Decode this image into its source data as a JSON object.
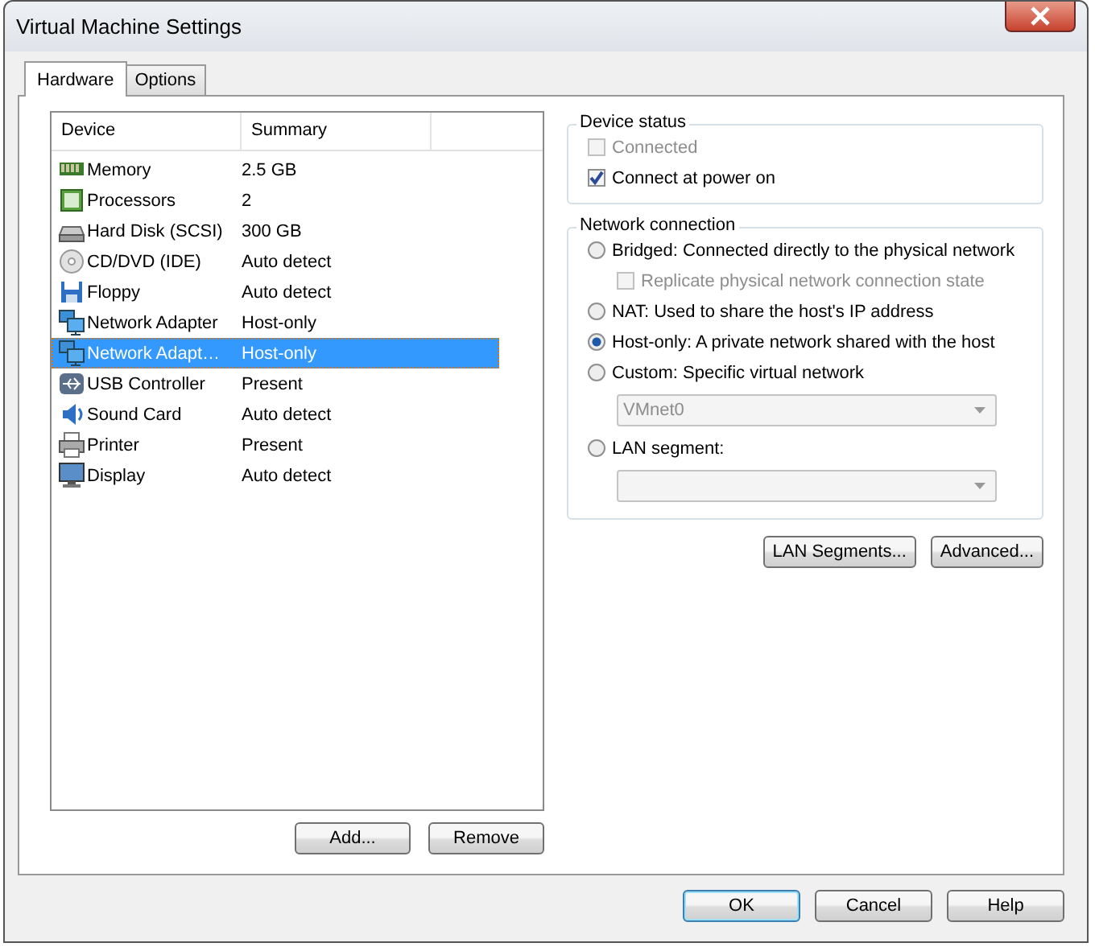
{
  "window": {
    "title": "Virtual Machine Settings"
  },
  "tabs": [
    {
      "label": "Hardware",
      "selected": true
    },
    {
      "label": "Options",
      "selected": false
    }
  ],
  "device_list": {
    "columns": [
      "Device",
      "Summary"
    ],
    "rows": [
      {
        "kind": "memory",
        "device": "Memory",
        "summary": "2.5 GB",
        "selected": false
      },
      {
        "kind": "cpu",
        "device": "Processors",
        "summary": "2",
        "selected": false
      },
      {
        "kind": "disk",
        "device": "Hard Disk (SCSI)",
        "summary": "300 GB",
        "selected": false
      },
      {
        "kind": "cd",
        "device": "CD/DVD (IDE)",
        "summary": "Auto detect",
        "selected": false
      },
      {
        "kind": "floppy",
        "device": "Floppy",
        "summary": "Auto detect",
        "selected": false
      },
      {
        "kind": "network",
        "device": "Network Adapter",
        "summary": "Host-only",
        "selected": false
      },
      {
        "kind": "network",
        "device": "Network Adapt…",
        "summary": "Host-only",
        "selected": true
      },
      {
        "kind": "usb",
        "device": "USB Controller",
        "summary": "Present",
        "selected": false
      },
      {
        "kind": "sound",
        "device": "Sound Card",
        "summary": "Auto detect",
        "selected": false
      },
      {
        "kind": "printer",
        "device": "Printer",
        "summary": "Present",
        "selected": false
      },
      {
        "kind": "display",
        "device": "Display",
        "summary": "Auto detect",
        "selected": false
      }
    ],
    "buttons": [
      "Add...",
      "Remove"
    ]
  },
  "device_status": {
    "title": "Device status",
    "options": [
      {
        "label": "Connected",
        "checked": false,
        "disabled": true
      },
      {
        "label": "Connect at power on",
        "checked": true,
        "disabled": false
      }
    ]
  },
  "network_connection": {
    "title": "Network connection",
    "options": [
      {
        "kind": "radio",
        "label": "Bridged: Connected directly to the physical network",
        "selected": false
      },
      {
        "kind": "checkbox",
        "label": "Replicate physical network connection state",
        "checked": false,
        "disabled": true
      },
      {
        "kind": "radio",
        "label": "NAT: Used to share the host's IP address",
        "selected": false
      },
      {
        "kind": "radio",
        "label": "Host-only: A private network shared with the host",
        "selected": true
      },
      {
        "kind": "radio",
        "label": "Custom: Specific virtual network",
        "selected": false
      },
      {
        "kind": "dropdown",
        "value": "VMnet0",
        "disabled": true
      },
      {
        "kind": "radio",
        "label": "LAN segment:",
        "selected": false
      },
      {
        "kind": "dropdown",
        "disabled": true
      }
    ]
  },
  "network_buttons": [
    "LAN Segments...",
    "Advanced..."
  ],
  "dialog_buttons": [
    {
      "label": "OK",
      "default": true
    },
    {
      "label": "Cancel",
      "default": false
    },
    {
      "label": "Help",
      "default": false
    }
  ]
}
